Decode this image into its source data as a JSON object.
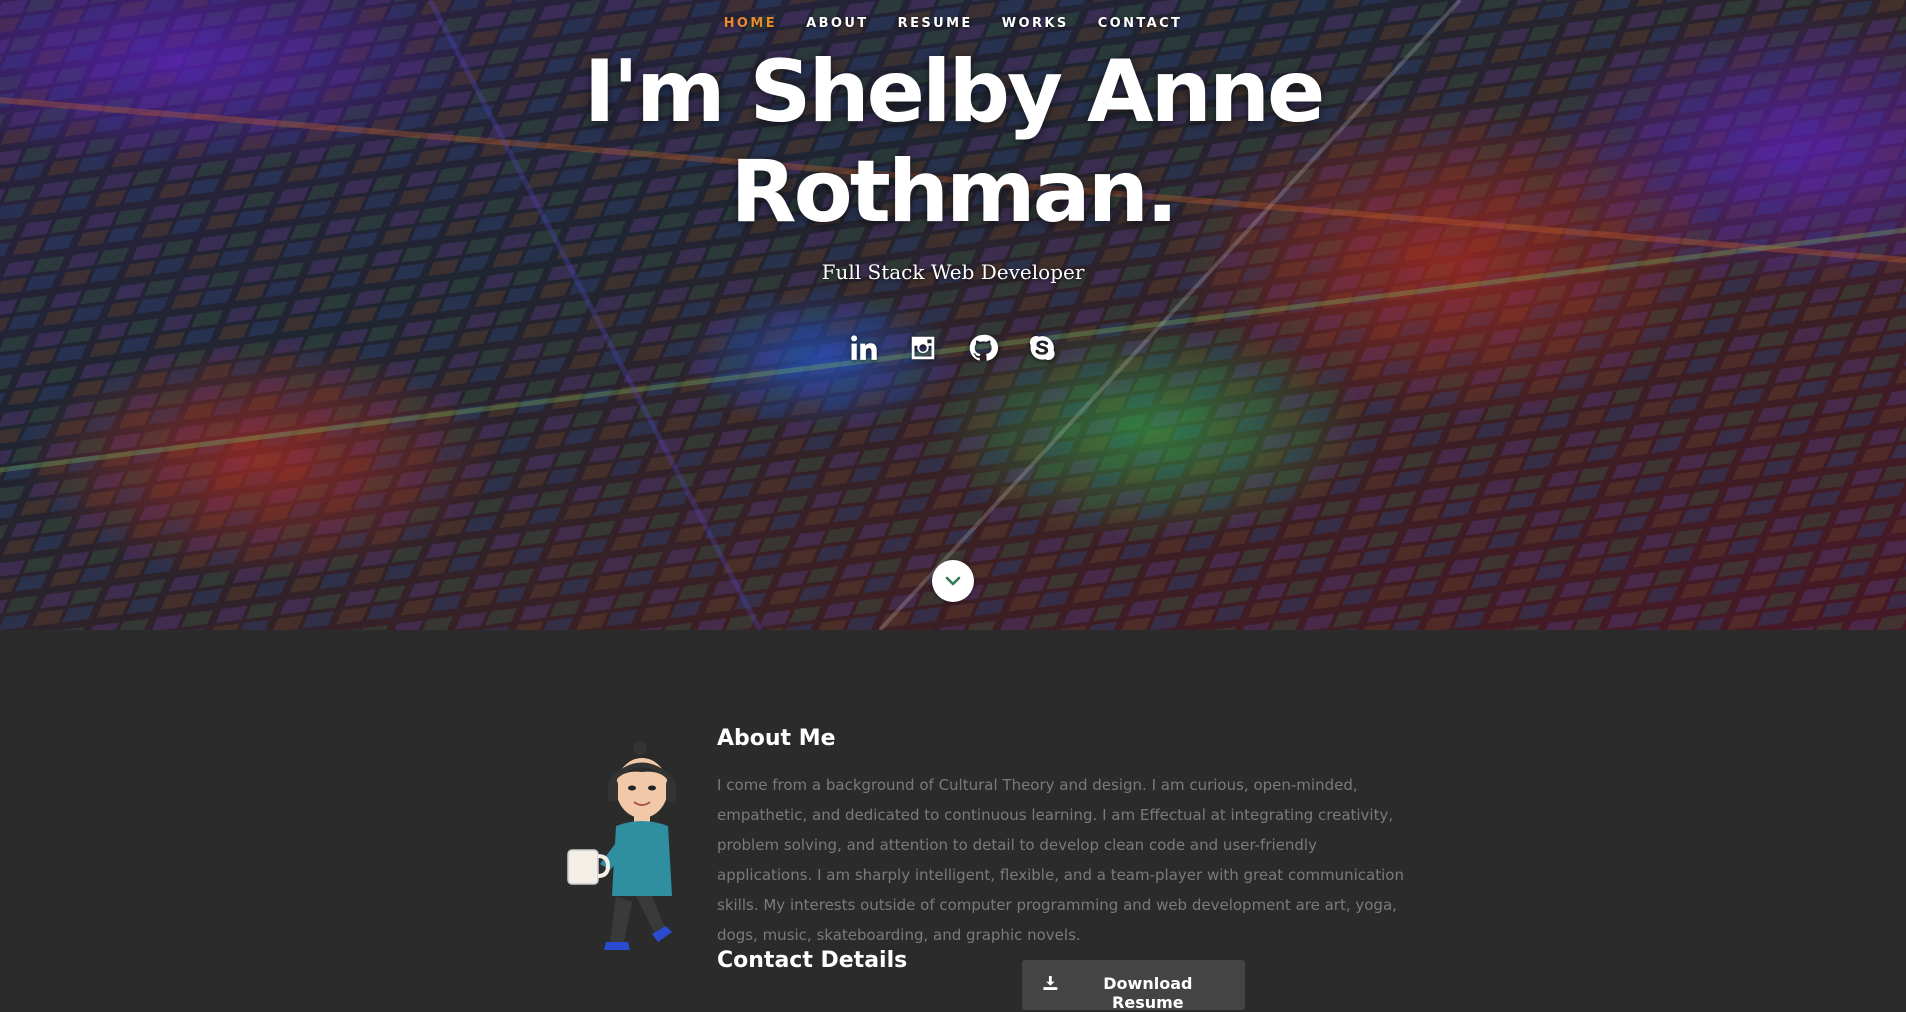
{
  "nav": {
    "items": [
      {
        "label": "HOME",
        "active": true
      },
      {
        "label": "ABOUT",
        "active": false
      },
      {
        "label": "RESUME",
        "active": false
      },
      {
        "label": "WORKS",
        "active": false
      },
      {
        "label": "CONTACT",
        "active": false
      }
    ],
    "active_color": "#e98a2f"
  },
  "hero": {
    "title_line1": "I'm Shelby Anne",
    "title_line2": "Rothman.",
    "subtitle": "Full Stack Web Developer",
    "social": [
      {
        "icon": "linkedin-icon"
      },
      {
        "icon": "instagram-icon"
      },
      {
        "icon": "github-icon"
      },
      {
        "icon": "skype-icon"
      }
    ],
    "scroll_icon": "chevron-down-icon"
  },
  "about": {
    "title": "About Me",
    "text": "I come from a background of Cultural Theory and design. I am curious, open-minded, empathetic, and dedicated to continuous learning. I am Effectual at integrating creativity, problem solving, and attention to detail to develop clean code and user-friendly applications. I am sharply intelligent, flexible, and a team-player with great communication skills. My interests outside of computer programming and web development are art, yoga, dogs, music, skateboarding, and graphic novels.",
    "contact_title": "Contact Details",
    "download_label": "Download Resume",
    "download_icon": "download-icon"
  }
}
